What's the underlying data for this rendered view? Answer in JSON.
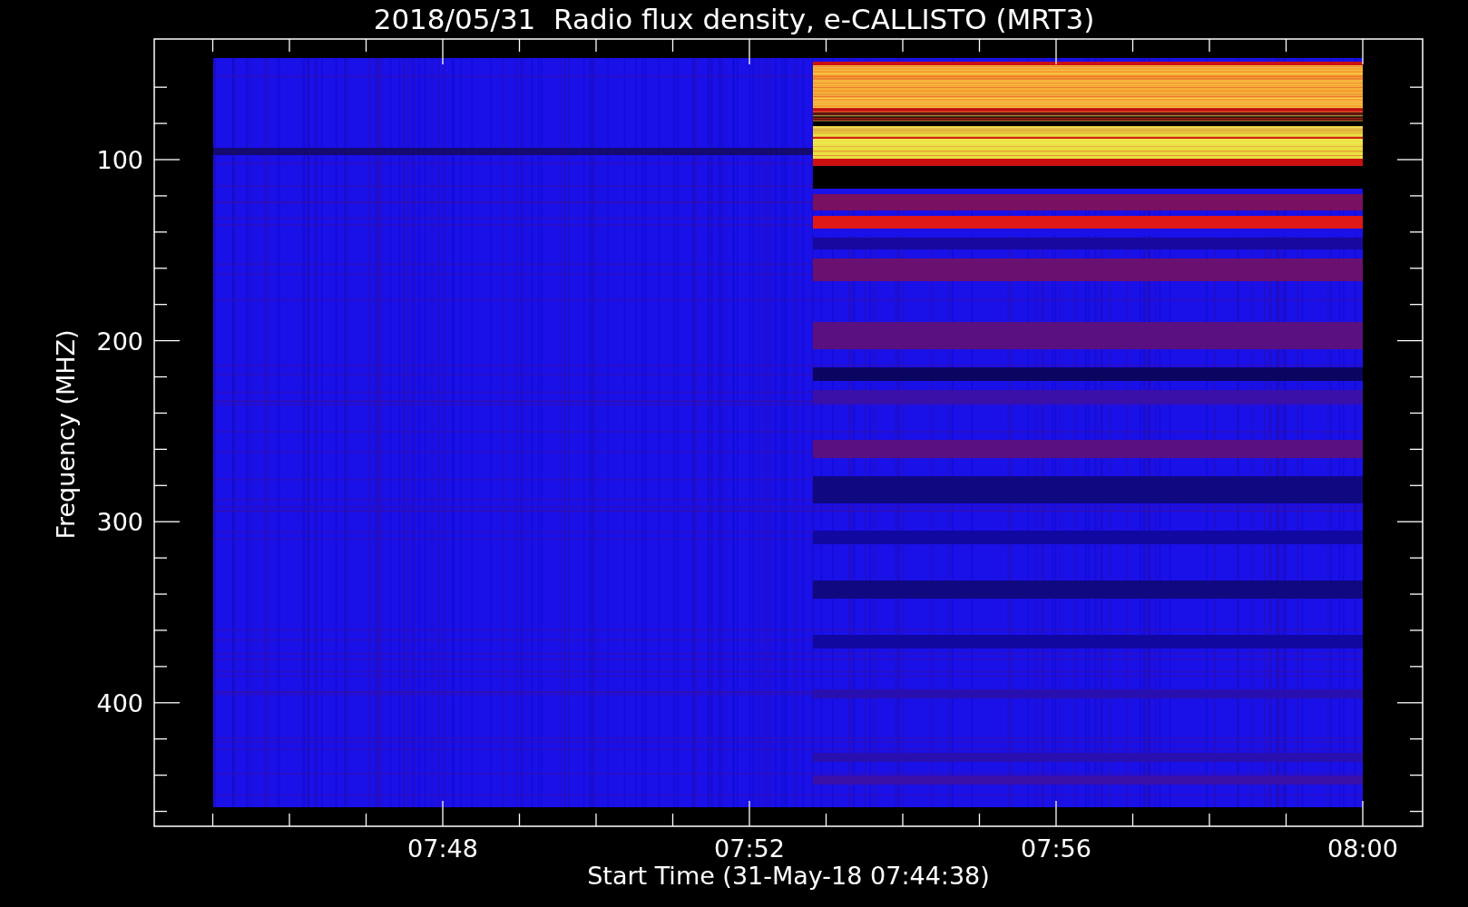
{
  "title": "2018/05/31  Radio flux density, e-CALLISTO (MRT3)",
  "chart": {
    "xlabel": "Start Time (31-May-18 07:44:38)",
    "ylabel": "Frequency (MHZ)",
    "xtick_labels": [
      "07:48",
      "07:52",
      "07:56",
      "08:00"
    ],
    "ytick_labels": [
      "100",
      "200",
      "300",
      "400"
    ]
  }
}
